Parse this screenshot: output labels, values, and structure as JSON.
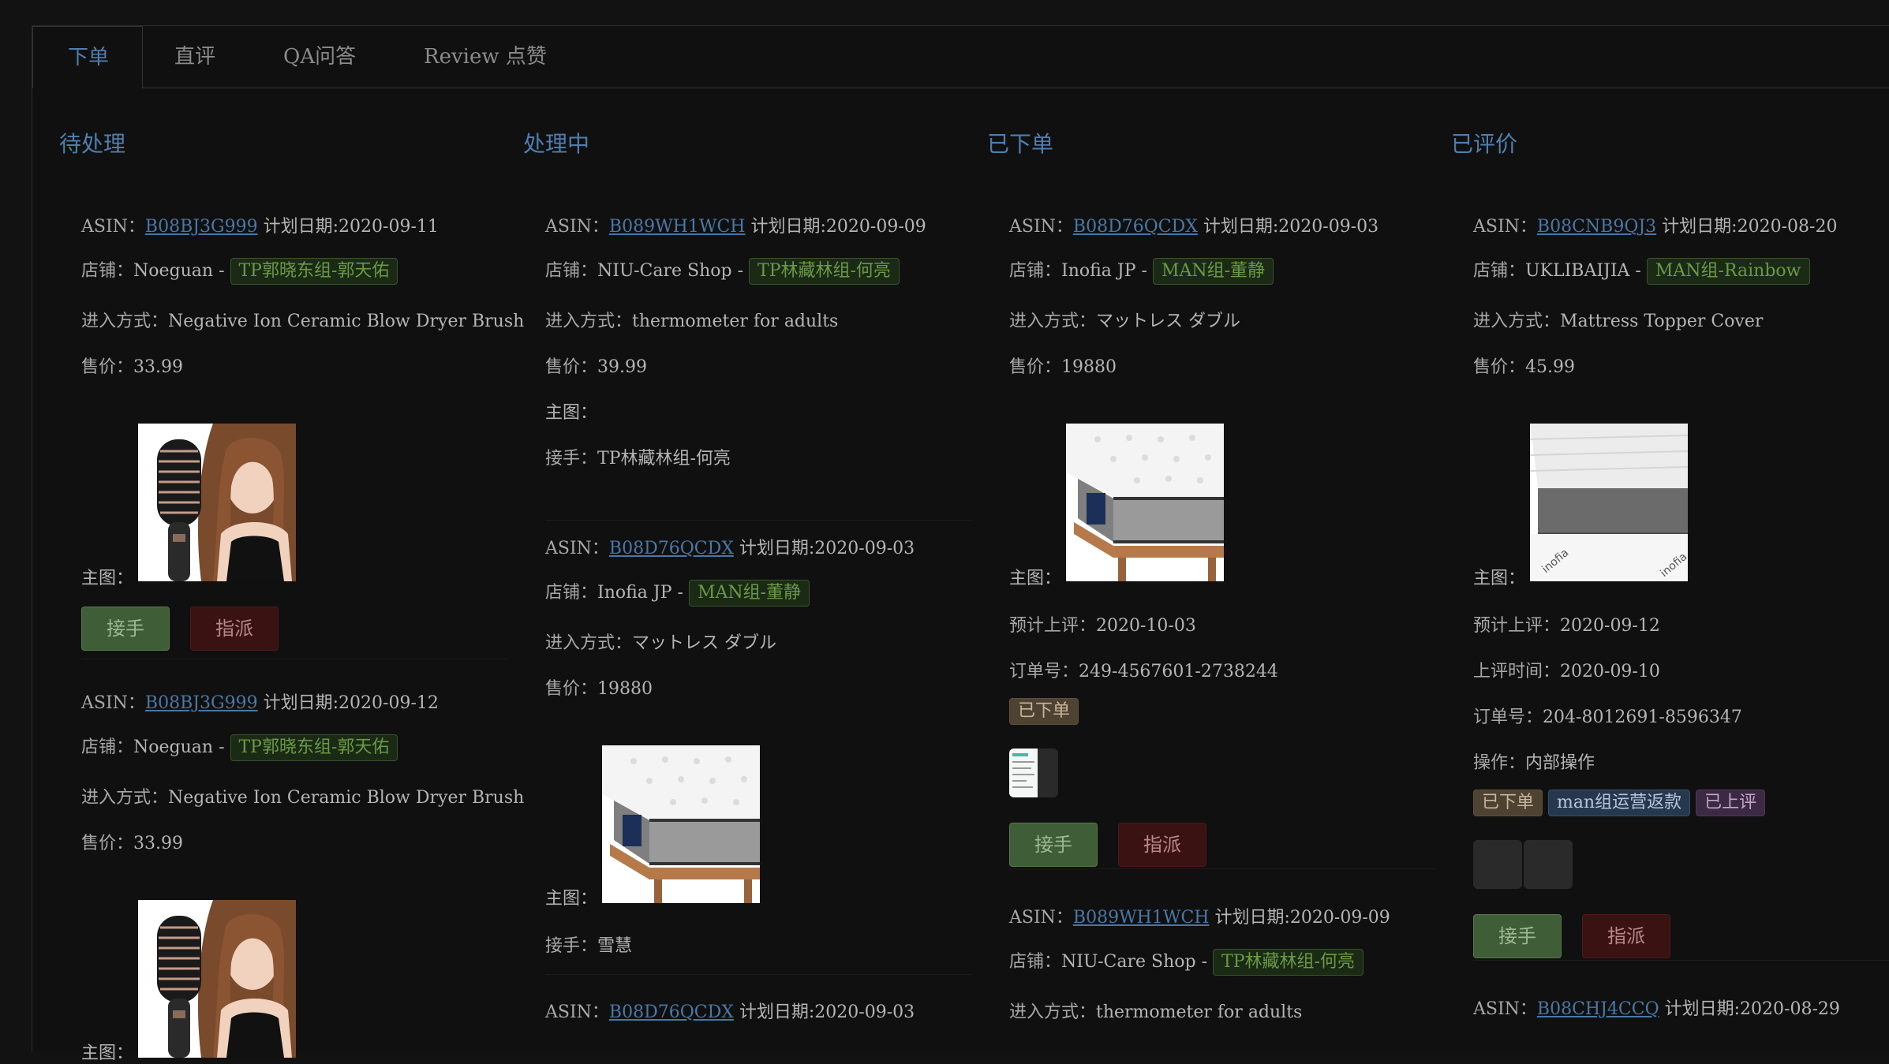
{
  "tabs": [
    {
      "label": "下单"
    },
    {
      "label": "直评"
    },
    {
      "label": "QA问答"
    },
    {
      "label": "Review 点赞"
    }
  ],
  "columns": [
    {
      "title": "待处理"
    },
    {
      "title": "处理中"
    },
    {
      "title": "已下单"
    },
    {
      "title": "已评价"
    }
  ],
  "labels": {
    "asin": "ASIN：",
    "plan_date": "计划日期:",
    "shop": "店铺：",
    "entry": "进入方式：",
    "price": "售价：",
    "main_image": "主图：",
    "handler": "接手：",
    "expected_review": "预计上评：",
    "review_time": "上评时间：",
    "order_no": "订单号：",
    "operation": "操作：",
    "dash": " - "
  },
  "buttons": {
    "accept": "接手",
    "assign": "指派"
  },
  "pending": [
    {
      "asin": "B08BJ3G999",
      "date": "2020-09-11",
      "shop": "Noeguan",
      "group": "TP郭晓东组-郭天佑",
      "entry": "Negative Ion Ceramic Blow Dryer Brush",
      "price": "33.99"
    },
    {
      "asin": "B08BJ3G999",
      "date": "2020-09-12",
      "shop": "Noeguan",
      "group": "TP郭晓东组-郭天佑",
      "entry": "Negative Ion Ceramic Blow Dryer Brush",
      "price": "33.99"
    }
  ],
  "processing": [
    {
      "asin": "B089WH1WCH",
      "date": "2020-09-09",
      "shop": "NIU-Care Shop",
      "group": "TP林藏林组-何亮",
      "entry": "thermometer for adults",
      "price": "39.99",
      "handler": "TP林藏林组-何亮"
    },
    {
      "asin": "B08D76QCDX",
      "date": "2020-09-03",
      "shop": "Inofia JP",
      "group": "MAN组-董静",
      "entry": "マットレス ダブル",
      "price": "19880",
      "handler": "雪慧"
    },
    {
      "asin": "B08D76QCDX",
      "date": "2020-09-03"
    }
  ],
  "ordered": [
    {
      "asin": "B08D76QCDX",
      "date": "2020-09-03",
      "shop": "Inofia JP",
      "group": "MAN组-董静",
      "entry": "マットレス ダブル",
      "price": "19880",
      "expected_review": "2020-10-03",
      "order_no": "249-4567601-2738244",
      "status": "已下单"
    },
    {
      "asin": "B089WH1WCH",
      "date": "2020-09-09",
      "shop": "NIU-Care Shop",
      "group": "TP林藏林组-何亮",
      "entry": "thermometer for adults"
    }
  ],
  "reviewed": [
    {
      "asin": "B08CNB9QJ3",
      "date": "2020-08-20",
      "shop": "UKLIBAIJIA",
      "group": "MAN组-Rainbow",
      "entry": "Mattress Topper Cover",
      "price": "45.99",
      "expected_review": "2020-09-12",
      "review_time": "2020-09-10",
      "order_no": "204-8012691-8596347",
      "operation": "内部操作",
      "tags": [
        "已下单",
        "man组运营返款",
        "已上评"
      ]
    },
    {
      "asin": "B08CHJ4CCQ",
      "date": "2020-08-29"
    }
  ],
  "colors": {
    "link": "#4a78a6",
    "accent": "#4e7fb0",
    "tag_green": "#6a9a46",
    "accept": "#3f5d37",
    "assign": "#3a1212"
  },
  "icons": [
    "hair-dryer-brush-photo",
    "mattress-photo",
    "mattress-topper-photo",
    "receipt-screenshot-thumb"
  ]
}
